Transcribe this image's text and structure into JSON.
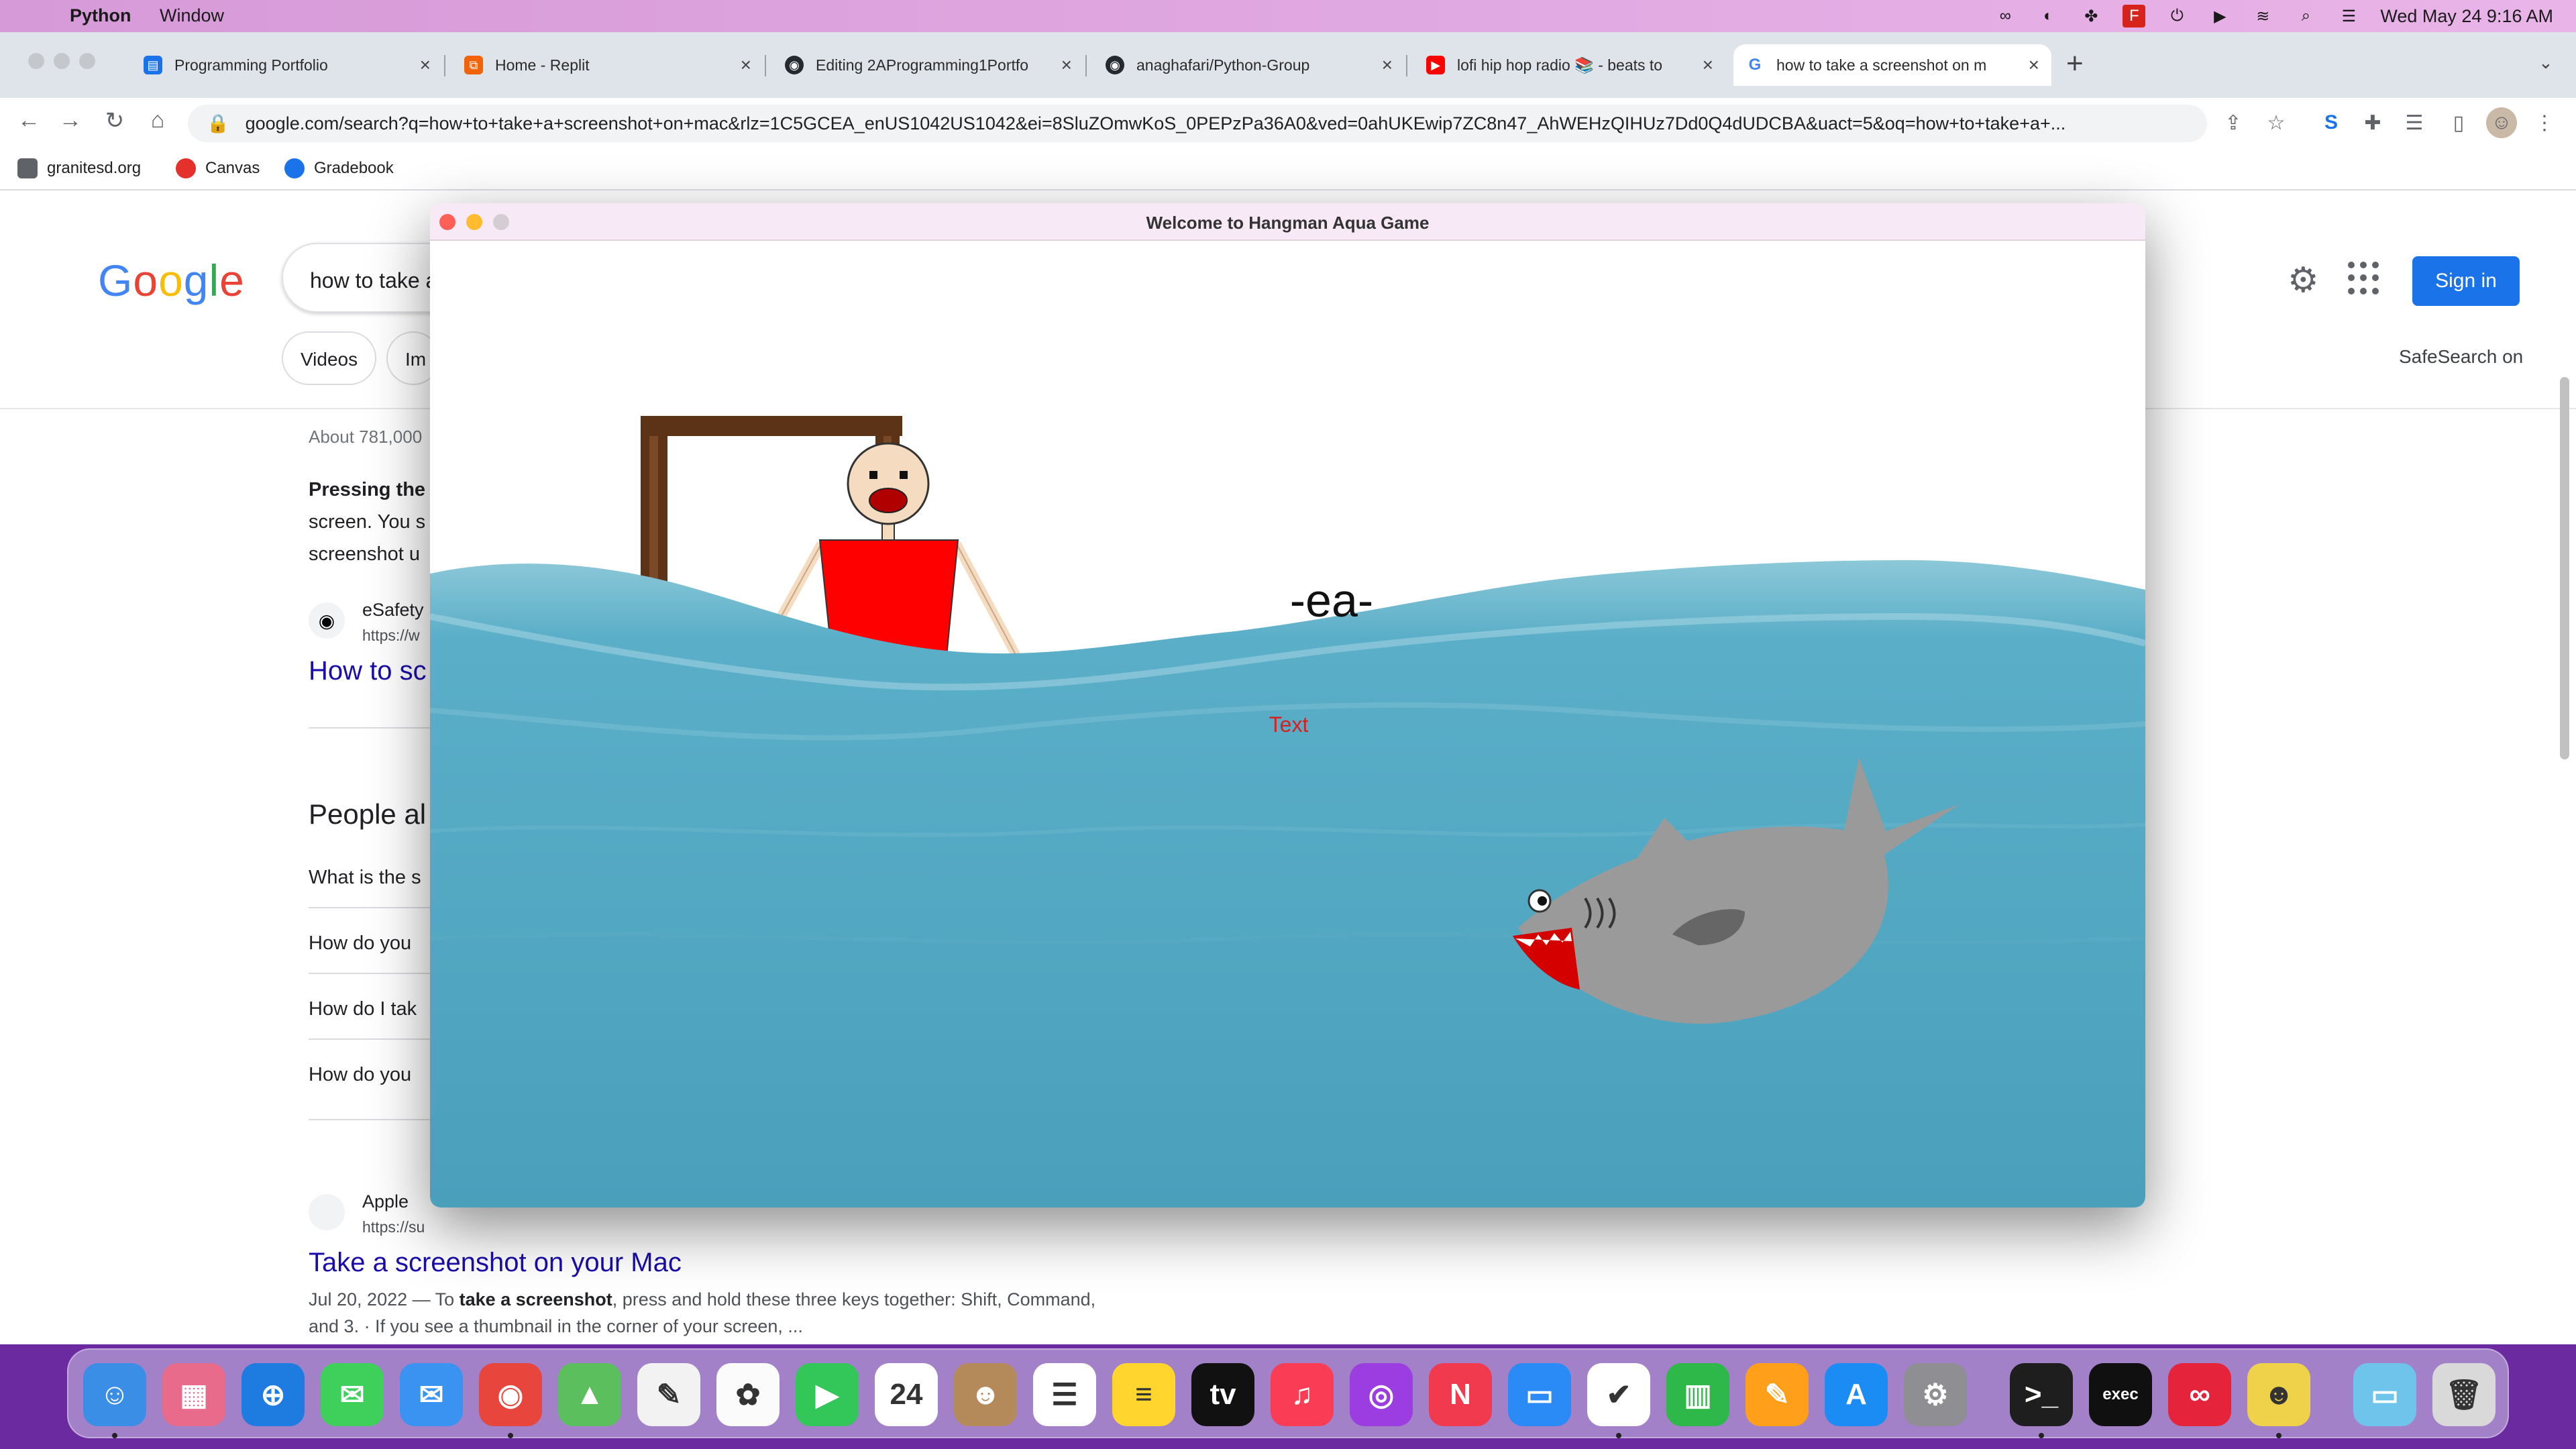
{
  "menubar": {
    "app_name": "Python",
    "menu_window": "Window",
    "datetime": "Wed May 24  9:16 AM"
  },
  "tabs": [
    {
      "title": "Programming Portfolio",
      "icon": "google-sites-icon",
      "color": "#1a73e8"
    },
    {
      "title": "Home - Replit",
      "icon": "replit-icon",
      "color": "#f26207"
    },
    {
      "title": "Editing 2AProgramming1Portfo",
      "icon": "github-icon",
      "color": "#24292f"
    },
    {
      "title": "anaghafari/Python-Group",
      "icon": "github-icon",
      "color": "#24292f"
    },
    {
      "title": "lofi hip hop radio 📚 - beats to",
      "icon": "youtube-icon",
      "color": "#ff0000"
    },
    {
      "title": "how to take a screenshot on m",
      "icon": "google-icon",
      "color": "#4285f4"
    }
  ],
  "omnibox": {
    "url": "google.com/search?q=how+to+take+a+screenshot+on+mac&rlz=1C5GCEA_enUS1042US1042&ei=8SluZOmwKoS_0PEPzPa36A0&ved=0ahUKEwip7ZC8n47_AhWEHzQIHUz7Dd0Q4dUDCBA&uact=5&oq=how+to+take+a+..."
  },
  "bookmarks": [
    {
      "label": "granitesd.org",
      "color": "#5f6368"
    },
    {
      "label": "Canvas",
      "color": "#e4312b"
    },
    {
      "label": "Gradebook",
      "color": "#1a73e8"
    }
  ],
  "google": {
    "logo": "Google",
    "query": "how to take a",
    "chips": [
      "Videos",
      "Im"
    ],
    "safesearch": "SafeSearch on",
    "signin": "Sign in",
    "about": "About 781,000",
    "snippet_bold": "Pressing the",
    "snippet_line2": "screen. You s",
    "snippet_line3": "screenshot u",
    "result1": {
      "site": "eSafety",
      "url": "https://w",
      "title": "How to sc"
    },
    "paa_heading": "People al",
    "paa": [
      "What is the s",
      "How do you",
      "How do I tak",
      "How do you"
    ],
    "result2": {
      "site": "Apple",
      "url": "https://su",
      "title": "Take a screenshot on your Mac",
      "date": "Jul 20, 2022 — To ",
      "bold": "take a screenshot",
      "rest": ", press and hold these three keys together: Shift, Command,",
      "line2": "and 3. · If you see a thumbnail in the corner of your screen, ..."
    }
  },
  "game": {
    "title": "Welcome to Hangman Aqua Game",
    "word": "-ea-",
    "text_label": "Text",
    "colors": {
      "water": "#4ba2bd",
      "gallows": "#5c3317",
      "shirt": "#ff0000",
      "skin": "#f5dcc0",
      "shark": "#9a9a9a",
      "mouth": "#d40000"
    }
  },
  "dock": [
    {
      "name": "finder-icon",
      "color": "#3a8ee6",
      "glyph": "☺"
    },
    {
      "name": "launchpad-icon",
      "color": "#e86b8b",
      "glyph": "▦"
    },
    {
      "name": "safari-icon",
      "color": "#1e7be0",
      "glyph": "⊕"
    },
    {
      "name": "messages-icon",
      "color": "#3ed05b",
      "glyph": "✉"
    },
    {
      "name": "mail-icon",
      "color": "#3a93f0",
      "glyph": "✉"
    },
    {
      "name": "chrome-icon",
      "color": "#e8453c",
      "glyph": "◉"
    },
    {
      "name": "maps-icon",
      "color": "#5bbf5d",
      "glyph": "▲"
    },
    {
      "name": "python-launcher-icon",
      "color": "#f2f2f2",
      "glyph": "✎"
    },
    {
      "name": "photos-icon",
      "color": "#fbfbfb",
      "glyph": "✿"
    },
    {
      "name": "facetime-icon",
      "color": "#33c759",
      "glyph": "▶"
    },
    {
      "name": "calendar-icon",
      "color": "#ffffff",
      "glyph": "24"
    },
    {
      "name": "contacts-icon",
      "color": "#b58a5a",
      "glyph": "☻"
    },
    {
      "name": "reminders-icon",
      "color": "#ffffff",
      "glyph": "☰"
    },
    {
      "name": "notes-icon",
      "color": "#ffd52e",
      "glyph": "≡"
    },
    {
      "name": "apple-tv-icon",
      "color": "#111111",
      "glyph": "tv"
    },
    {
      "name": "music-icon",
      "color": "#fa3c55",
      "glyph": "♫"
    },
    {
      "name": "podcasts-icon",
      "color": "#9b3de0",
      "glyph": "◎"
    },
    {
      "name": "news-icon",
      "color": "#f23a4e",
      "glyph": "N"
    },
    {
      "name": "keynote-icon",
      "color": "#2a8af6",
      "glyph": "▭"
    },
    {
      "name": "replit-desktop-icon",
      "color": "#ffffff",
      "glyph": "✔"
    },
    {
      "name": "numbers-icon",
      "color": "#2fb84a",
      "glyph": "▥"
    },
    {
      "name": "pages-icon",
      "color": "#ff9f1a",
      "glyph": "✎"
    },
    {
      "name": "app-store-icon",
      "color": "#1b8cf3",
      "glyph": "A"
    },
    {
      "name": "system-settings-icon",
      "color": "#8e8e93",
      "glyph": "⚙"
    },
    {
      "name": "terminal-icon",
      "color": "#1e1e1e",
      "glyph": ">_"
    },
    {
      "name": "exec-terminal-icon",
      "color": "#101010",
      "glyph": "exec"
    },
    {
      "name": "creative-cloud-icon",
      "color": "#e5233b",
      "glyph": "∞"
    },
    {
      "name": "python-idle-icon",
      "color": "#f0d14a",
      "glyph": "☻"
    },
    {
      "name": "downloads-folder-icon",
      "color": "#6ec4ea",
      "glyph": "▭"
    },
    {
      "name": "trash-icon",
      "color": "#d9d9d9",
      "glyph": "🗑"
    }
  ]
}
